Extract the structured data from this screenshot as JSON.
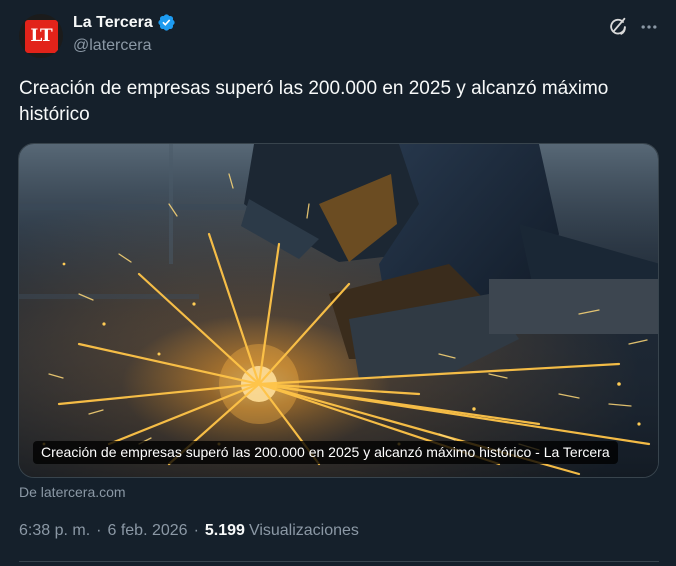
{
  "author": {
    "display_name": "La Tercera",
    "handle": "@latercera",
    "avatar_text": "LT",
    "verified": true
  },
  "tweet": {
    "text": "Creación de empresas superó las 200.000 en 2025 y alcanzó máximo histórico"
  },
  "card": {
    "caption": "Creación de empresas superó las 200.000 en 2025 y alcanzó máximo histórico - La Tercera",
    "source": "De latercera.com"
  },
  "meta": {
    "time": "6:38 p. m.",
    "separator": "·",
    "date": "6 feb. 2026",
    "views_count": "5.199",
    "views_label": "Visualizaciones"
  },
  "icons": {
    "verified": "verified-badge-icon",
    "grok": "grok-icon",
    "more": "more-icon"
  },
  "colors": {
    "background": "#15202b",
    "verified": "#1d9bf0",
    "muted": "#8b98a5",
    "brand_red": "#e2231a"
  }
}
